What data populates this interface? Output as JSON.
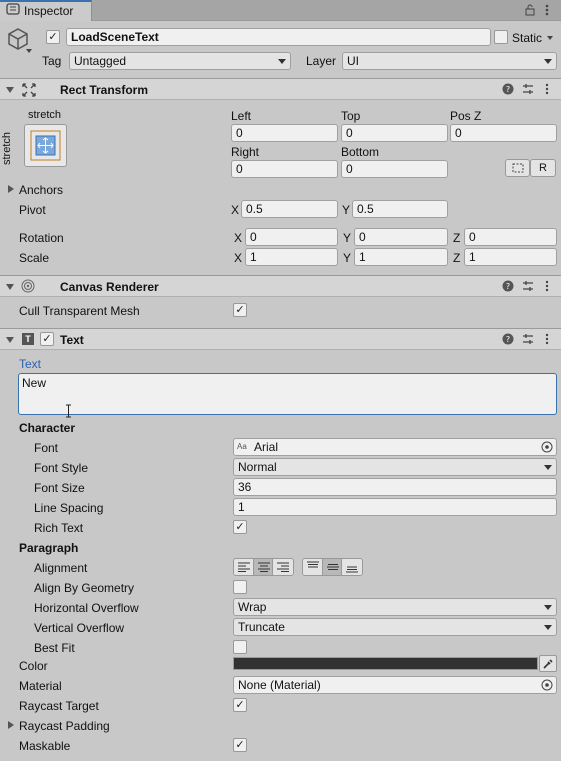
{
  "window": {
    "tab_title": "Inspector",
    "lock_icon": "lock-icon",
    "menu_icon": "kebab-menu-icon"
  },
  "header": {
    "object_name": "LoadSceneText",
    "active": true,
    "static_label": "Static",
    "static_checked": false,
    "tag_label": "Tag",
    "tag_value": "Untagged",
    "layer_label": "Layer",
    "layer_value": "UI"
  },
  "rect_transform": {
    "title": "Rect Transform",
    "anchor_preset_top": "stretch",
    "anchor_preset_left": "stretch",
    "left_label": "Left",
    "left_value": "0",
    "top_label": "Top",
    "top_value": "0",
    "posz_label": "Pos Z",
    "posz_value": "0",
    "right_label": "Right",
    "right_value": "0",
    "bottom_label": "Bottom",
    "bottom_value": "0",
    "raw_edit_label": "R",
    "anchors_label": "Anchors",
    "pivot_label": "Pivot",
    "pivot_x": "0.5",
    "pivot_y": "0.5",
    "rotation_label": "Rotation",
    "rot_x": "0",
    "rot_y": "0",
    "rot_z": "0",
    "scale_label": "Scale",
    "scale_x": "1",
    "scale_y": "1",
    "scale_z": "1",
    "x_label": "X",
    "y_label": "Y",
    "z_label": "Z"
  },
  "canvas_renderer": {
    "title": "Canvas Renderer",
    "cull_label": "Cull Transparent Mesh",
    "cull_checked": true
  },
  "text_component": {
    "title": "Text",
    "enabled": true,
    "text_label": "Text",
    "text_value": "New",
    "character_label": "Character",
    "font_label": "Font",
    "font_value": "Arial",
    "font_style_label": "Font Style",
    "font_style_value": "Normal",
    "font_size_label": "Font Size",
    "font_size_value": "36",
    "line_spacing_label": "Line Spacing",
    "line_spacing_value": "1",
    "rich_text_label": "Rich Text",
    "rich_text_checked": true,
    "paragraph_label": "Paragraph",
    "alignment_label": "Alignment",
    "align_by_geometry_label": "Align By Geometry",
    "align_by_geometry_checked": false,
    "h_overflow_label": "Horizontal Overflow",
    "h_overflow_value": "Wrap",
    "v_overflow_label": "Vertical Overflow",
    "v_overflow_value": "Truncate",
    "best_fit_label": "Best Fit",
    "best_fit_checked": false,
    "color_label": "Color",
    "color_value": "#323232",
    "material_label": "Material",
    "material_value": "None (Material)",
    "raycast_target_label": "Raycast Target",
    "raycast_target_checked": true,
    "raycast_padding_label": "Raycast Padding",
    "maskable_label": "Maskable",
    "maskable_checked": true
  },
  "checkmark": "✓"
}
